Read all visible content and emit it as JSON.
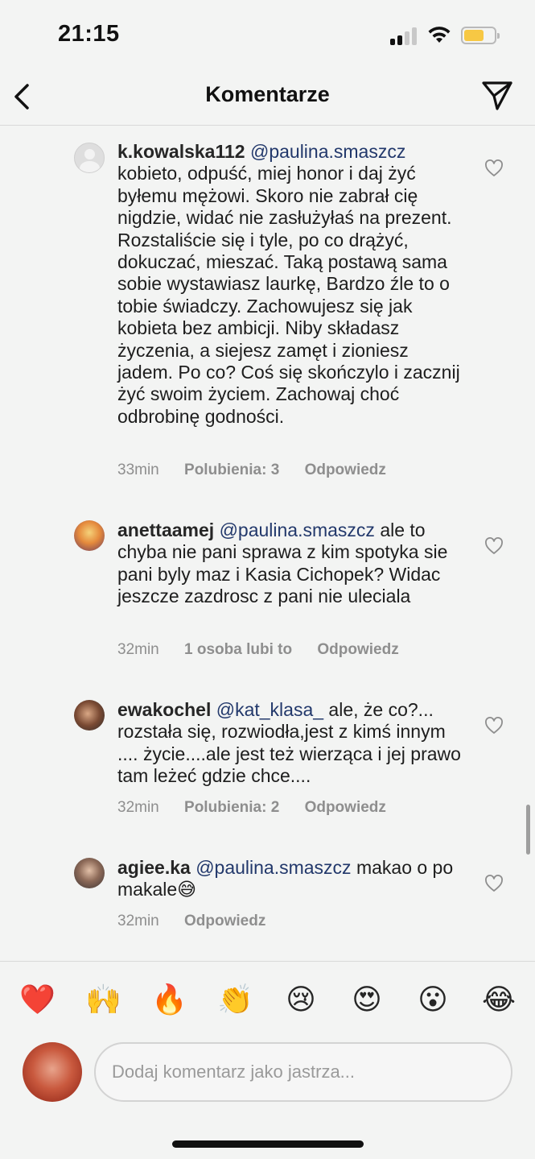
{
  "status_bar": {
    "time": "21:15",
    "battery_level": 0.55,
    "signal_bars": 2
  },
  "header": {
    "title": "Komentarze"
  },
  "colors": {
    "background": "#f3f4f3",
    "mention": "#22386b",
    "meta": "#8e8e8e"
  },
  "comments": [
    {
      "username": "k.kowalska112",
      "mention": "@paulina.smaszcz",
      "text": " kobieto, odpuść, miej honor i daj żyć byłemu mężowi. Skoro nie zabrał cię nigdzie, widać nie zasłużyłaś na prezent. Rozstaliście się i tyle, po co drążyć, dokuczać, mieszać. Taką postawą sama sobie wystawiasz laurkę, Bardzo źle to o tobie świadczy. Zachowujesz się jak kobieta bez ambicji. Niby składasz życzenia, a siejesz zamęt i zioniesz jadem. Po co? Coś się skończylo i zacznij żyć swoim życiem. Zachowaj choć odbrobinę godności.",
      "time": "33min",
      "likes": "Polubienia: 3",
      "reply": "Odpowiedz"
    },
    {
      "username": "anettaamej",
      "mention": "@paulina.smaszcz",
      "text": " ale to chyba nie pani sprawa z kim spotyka sie pani byly maz i Kasia Cichopek? Widac jeszcze zazdrosc z pani nie uleciala",
      "time": "32min",
      "likes": "1 osoba lubi to",
      "reply": "Odpowiedz"
    },
    {
      "username": "ewakochel",
      "mention": "@kat_klasa_",
      "text": " ale, że co?... rozstała się, rozwiodła,jest z kimś innym .... życie....ale jest też wierząca i jej prawo tam leżeć gdzie chce....",
      "time": "32min",
      "likes": "Polubienia: 2",
      "reply": "Odpowiedz"
    },
    {
      "username": "agiee.ka",
      "mention": "@paulina.smaszcz",
      "text": " makao o po makale😅",
      "time": "32min",
      "likes": "",
      "reply": "Odpowiedz"
    }
  ],
  "emoji_bar": [
    "❤️",
    "🙌",
    "🔥",
    "👏",
    "😢",
    "😍",
    "😮",
    "😂"
  ],
  "comment_input": {
    "placeholder": "Dodaj komentarz jako jastrza..."
  }
}
